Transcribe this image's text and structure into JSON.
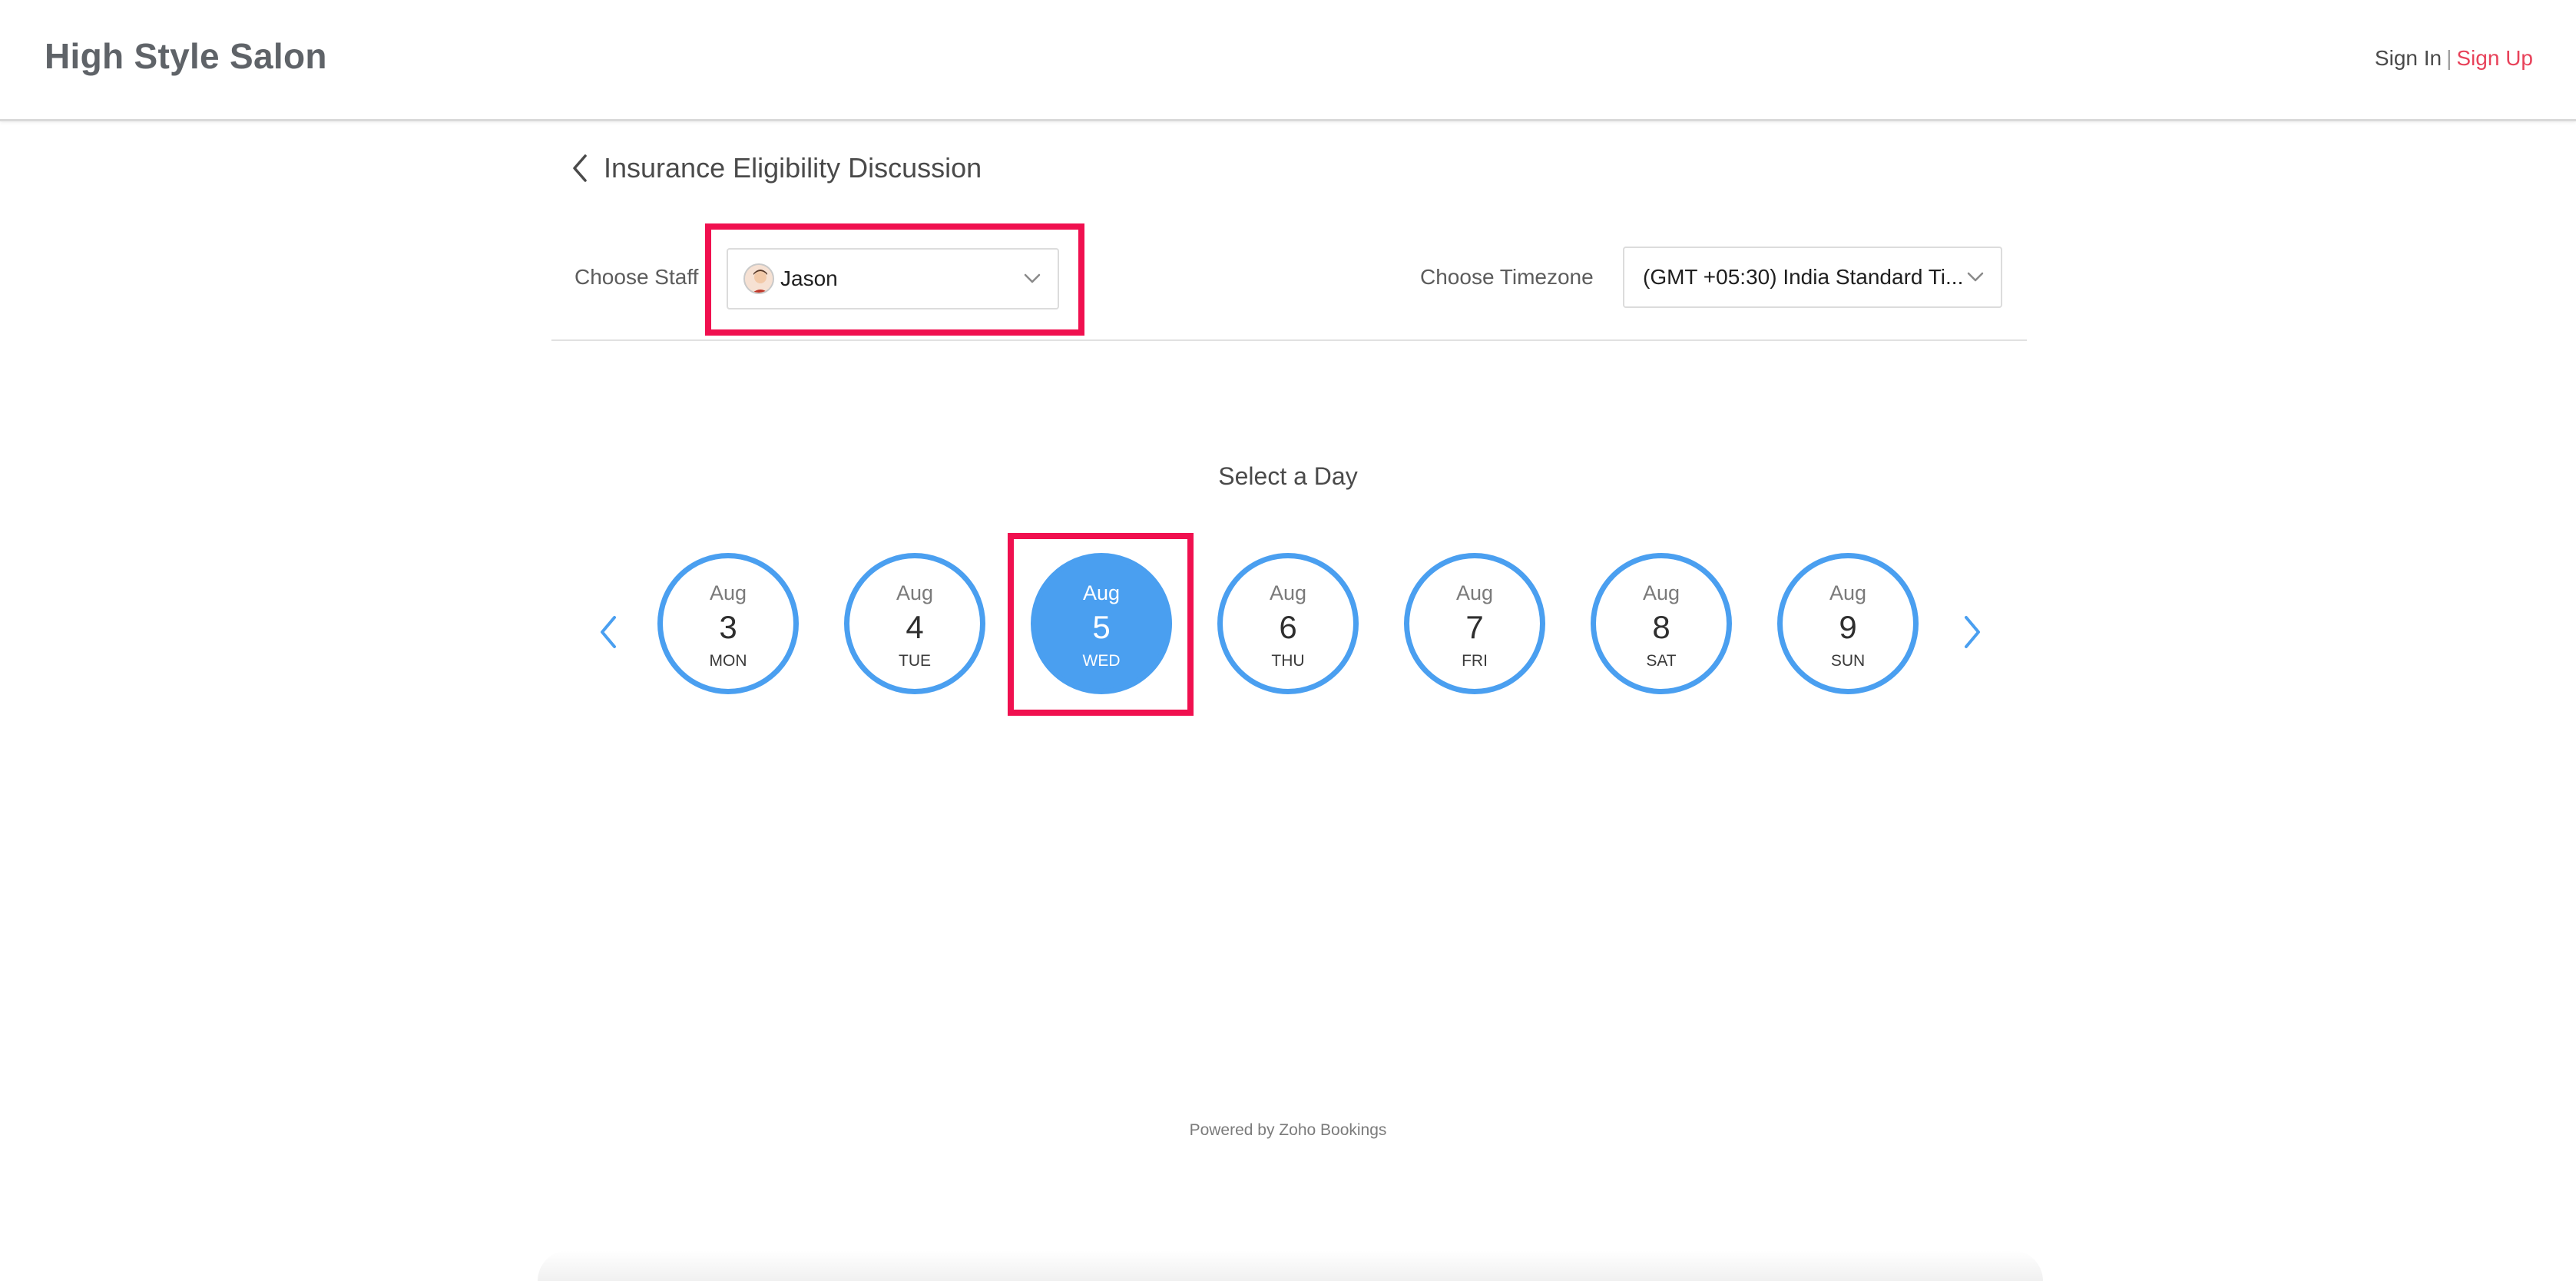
{
  "header": {
    "brand": "High Style Salon",
    "sign_in": "Sign In",
    "separator": "|",
    "sign_up": "Sign Up"
  },
  "service": {
    "title": "Insurance Eligibility Discussion",
    "back_icon": "chevron-left-icon"
  },
  "staff": {
    "label": "Choose Staff",
    "selected": "Jason",
    "avatar_icon": "user-avatar-icon"
  },
  "timezone": {
    "label": "Choose Timezone",
    "selected": "(GMT +05:30) India Standard Ti..."
  },
  "calendar": {
    "heading": "Select a Day",
    "prev_icon": "chevron-left-icon",
    "next_icon": "chevron-right-icon",
    "days": [
      {
        "month": "Aug",
        "date": "3",
        "weekday": "MON"
      },
      {
        "month": "Aug",
        "date": "4",
        "weekday": "TUE"
      },
      {
        "month": "Aug",
        "date": "5",
        "weekday": "WED"
      },
      {
        "month": "Aug",
        "date": "6",
        "weekday": "THU"
      },
      {
        "month": "Aug",
        "date": "7",
        "weekday": "FRI"
      },
      {
        "month": "Aug",
        "date": "8",
        "weekday": "SAT"
      },
      {
        "month": "Aug",
        "date": "9",
        "weekday": "SUN"
      }
    ],
    "selected_date": "5"
  },
  "footer": {
    "powered_by": "Powered by Zoho Bookings"
  },
  "colors": {
    "accent": "#4a9ff0",
    "highlight": "#f0104f",
    "sign_up": "#e8425a",
    "brand_text": "#5f6368"
  }
}
